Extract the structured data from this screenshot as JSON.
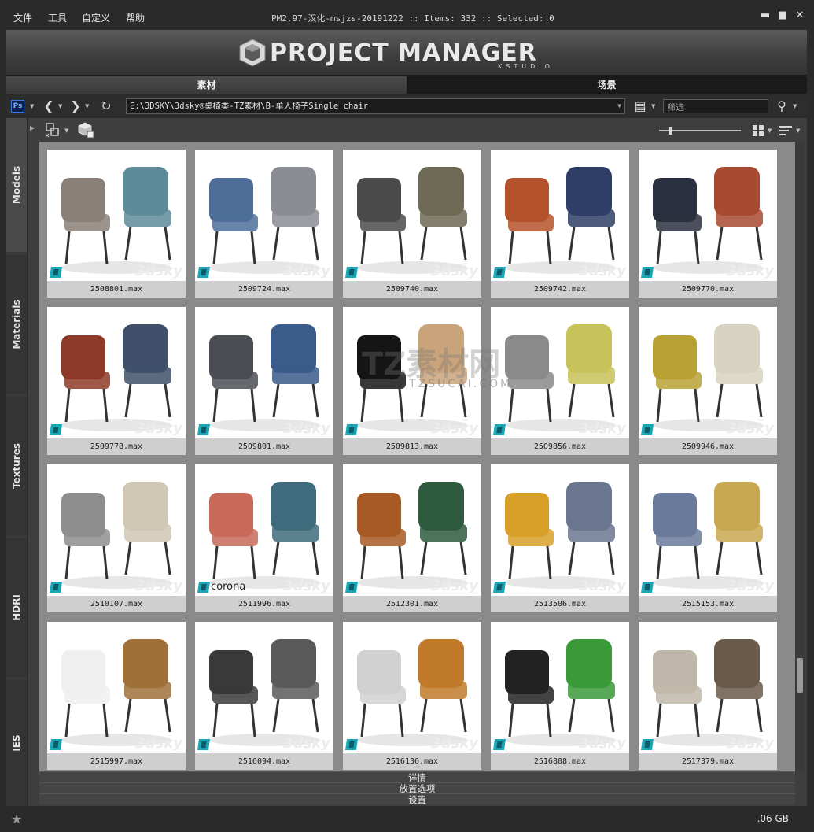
{
  "menu": {
    "file": "文件",
    "tools": "工具",
    "customize": "自定义",
    "help": "帮助"
  },
  "window": {
    "title": "PM2.97-汉化-msjzs-20191222 :: Items: 332 :: Selected: 0",
    "minimize": "▬",
    "maximize": "■",
    "close": "✕"
  },
  "logo": {
    "title": "PROJECT MANAGER",
    "subtitle": "KSTUDIO"
  },
  "tabs": {
    "assets": "素材",
    "scenes": "场景"
  },
  "toolbar": {
    "ps_label": "Ps",
    "path": "E:\\3DSKY\\3dsky®桌椅类-TZ素材\\B-单人椅子Single chair",
    "filter_placeholder": "筛选"
  },
  "sidebar": {
    "models": "Models",
    "materials": "Materials",
    "textures": "Textures",
    "hdri": "HDRI",
    "ies": "IES"
  },
  "items": [
    {
      "file": "2508801.max",
      "palette": [
        "#8b8078",
        "#5e8b9a"
      ]
    },
    {
      "file": "2509724.max",
      "palette": [
        "#4e6e99",
        "#8a8e93"
      ]
    },
    {
      "file": "2509740.max",
      "palette": [
        "#4a4a4a",
        "#6e6a55"
      ]
    },
    {
      "file": "2509742.max",
      "palette": [
        "#b4522c",
        "#2e3e66"
      ]
    },
    {
      "file": "2509770.max",
      "palette": [
        "#2b3040",
        "#a84a30"
      ]
    },
    {
      "file": "2509778.max",
      "palette": [
        "#8e3a28",
        "#40506a"
      ]
    },
    {
      "file": "2509801.max",
      "palette": [
        "#4a4d52",
        "#3b5b8a"
      ]
    },
    {
      "file": "2509813.max",
      "palette": [
        "#151515",
        "#c9a37a"
      ]
    },
    {
      "file": "2509856.max",
      "palette": [
        "#8a8a8a",
        "#c8c25a"
      ]
    },
    {
      "file": "2509946.max",
      "palette": [
        "#b8a234",
        "#d8d2c0"
      ]
    },
    {
      "file": "2510107.max",
      "palette": [
        "#8e8e8e",
        "#cfc6b4"
      ]
    },
    {
      "file": "2511996.max",
      "palette": [
        "#c86a5a",
        "#3f6c7c"
      ]
    },
    {
      "file": "2512301.max",
      "palette": [
        "#a85a24",
        "#2e5a3e"
      ]
    },
    {
      "file": "2513506.max",
      "palette": [
        "#d8a028",
        "#6a7690"
      ]
    },
    {
      "file": "2515153.max",
      "palette": [
        "#6a7a9a",
        "#c8a850"
      ]
    },
    {
      "file": "2515997.max",
      "palette": [
        "#efefef",
        "#a0703a"
      ]
    },
    {
      "file": "2516094.max",
      "palette": [
        "#3a3a3a",
        "#5a5a5a"
      ]
    },
    {
      "file": "2516136.max",
      "palette": [
        "#d0d0d0",
        "#c07a2a"
      ]
    },
    {
      "file": "2516808.max",
      "palette": [
        "#222222",
        "#3a9a3a"
      ]
    },
    {
      "file": "2517379.max",
      "palette": [
        "#bfb8aa",
        "#6a5a4a"
      ]
    }
  ],
  "watermarks": {
    "tz": "TZ素材网",
    "tzsub": "TZSUCAI.COM",
    "sky": "3dsky",
    "corona": "corona"
  },
  "panels": {
    "details": "详情",
    "placement": "放置选项",
    "settings": "设置"
  },
  "status": {
    "disk": ".06 GB"
  },
  "colors": {
    "bg": "#2b2b2b",
    "grid": "#8a8a8a",
    "max_badge": "#1aa6b7",
    "ps_border": "#3a7bd5"
  }
}
